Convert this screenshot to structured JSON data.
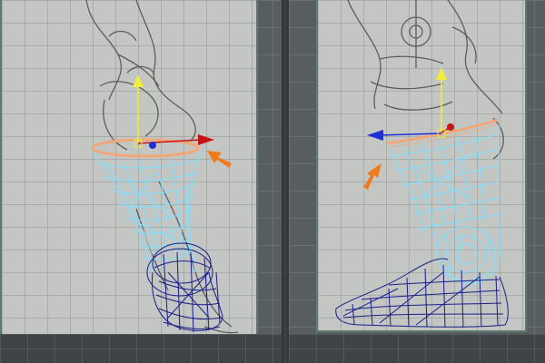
{
  "viewports": [
    {
      "name": "left-viewport",
      "colors": {
        "accent_ring": "#f0a878",
        "wireframe": "#7fe0ff",
        "mesh_dark": "#1a1f8a"
      },
      "icons": [
        "manipulator-y-axis-icon",
        "manipulator-x-axis-icon",
        "callout-arrow-icon"
      ]
    },
    {
      "name": "right-viewport",
      "colors": {
        "accent_ring": "#f0a878",
        "wireframe": "#7fe0ff",
        "mesh_dark": "#1a1f8a"
      },
      "icons": [
        "manipulator-y-axis-icon",
        "manipulator-x-axis-icon",
        "manipulator-z-axis-icon",
        "callout-arrow-icon"
      ]
    }
  ],
  "colors": {
    "callout_arrow": "#f07a1c",
    "y_axis": "#f2ee3a",
    "x_axis": "#c41414",
    "z_axis": "#1f2fd6"
  }
}
